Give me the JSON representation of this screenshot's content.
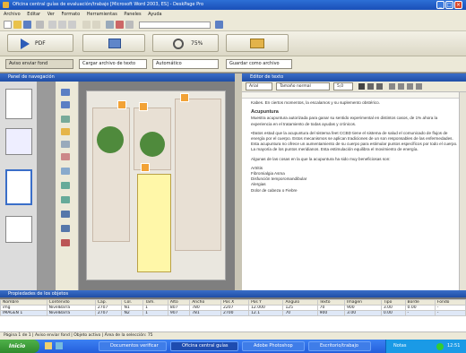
{
  "window": {
    "title": "Oficina central guías de evaluación/trabajo [Microsoft Word 2003, ES] - DeskPage Pro",
    "buttons": [
      "_",
      "□",
      "×"
    ]
  },
  "menu": [
    "Archivo",
    "Editar",
    "Ver",
    "Formato",
    "Herramientas",
    "Paneles",
    "Ayuda"
  ],
  "bigbar": {
    "btn1": "PDF",
    "btn2": "",
    "btn3": "75%",
    "btn4": ""
  },
  "selects": {
    "s1": "Aviso enviar fond",
    "s2": "Cargar archivo de texto",
    "s3": "Automático",
    "s4": "Guardar como archivo"
  },
  "panels": {
    "left_header": "Panel de navegación",
    "right_header": "Editor de texto",
    "bottom_header": "Propiedades de los objetos"
  },
  "editor": {
    "font": "Arial",
    "size": "Tamaño normal",
    "zoom": "5,0",
    "intro": "Kabes. En ciertos momentos, la escalamos y su suplemento obstérico.",
    "heading": "Acupuntura",
    "p1": "Muestra acupuntura autorizada para ganar su sentido experimental en distintos casos, de 1% ahora la experiencia en el tratamiento de todas ayudas y crónicos.",
    "p2": "•Datos estad que la acupuntura del sistema feet CCBD tiene el sistema de salud el comunicado de flujos de energía por el cuerpo. Estos mecanismos se aplican tradiciones de un son responsables de las enfermedades. Esta acupuntura no ofrece un aumentamiento de su cuerpo para estimular puntos específicos por todo el cuerpo. La mayoría de los puntos meridianos. Esta estimulación equilibra el movimiento de energía.",
    "p3": "Algunas de las cosas en la que la acupuntura ha sido muy beneficiosas son:",
    "list": [
      "Artritis",
      "Fibromialgia Asma",
      "Disfunción temporomandibular",
      "Alergias",
      "Dolor de cabeza o Fiebre"
    ]
  },
  "grid": {
    "columns": [
      "Nombre",
      "Contenido",
      "Cap.",
      "Col.",
      "Tam.",
      "Alto",
      "Ancho",
      "Pos X",
      "Pos Y",
      "Ángulo",
      "Texto",
      "Imagen",
      "Tipo",
      "Borde",
      "Fondo"
    ],
    "rows": [
      [
        "img",
        "NivelBarra",
        "2707",
        "N1",
        "1",
        "807",
        "780",
        "2207",
        "12.000",
        "125",
        "70",
        "900",
        "3.00",
        "0.00",
        "-"
      ],
      [
        "IMAGEN 1",
        "NivelBarra",
        "2707",
        "N2",
        "1",
        "907",
        "781",
        "2700",
        "12.1",
        "70",
        "900",
        "3.00",
        "0.00",
        "-",
        "-"
      ]
    ]
  },
  "statusbar": "Página 1 de 1 | Aviso enviar fond | Objeto activo | Área de la selección: 75",
  "taskbar": {
    "start": "Inicio",
    "tasks": [
      "Documentos verificar",
      "Oficina central guías",
      "Adobe Photoshop",
      "Escritorio/trabajo"
    ],
    "tray": "Notas",
    "clock": "12:51"
  },
  "colors": {
    "title": "#1f56c0",
    "ui": "#ece9d8",
    "workspace": "#7a7a7a",
    "accent": "#f2a236"
  }
}
